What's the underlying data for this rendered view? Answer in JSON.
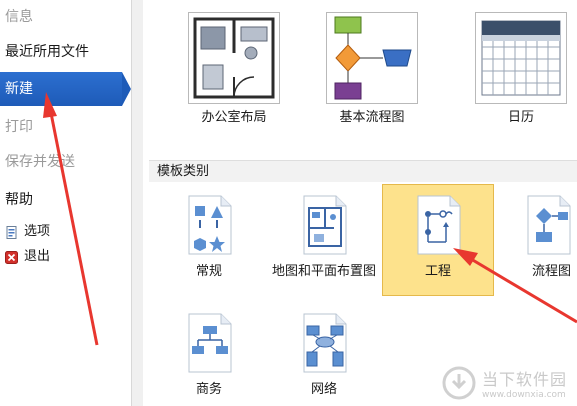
{
  "nav": {
    "info": "信息",
    "recent": "最近所用文件",
    "new": "新建",
    "print": "打印",
    "save_send": "保存并发送",
    "help": "帮助",
    "options": "选项",
    "exit": "退出"
  },
  "top_templates": [
    {
      "label": "办公室布局"
    },
    {
      "label": "基本流程图"
    },
    {
      "label": "日历"
    }
  ],
  "section": {
    "title": "模板类别"
  },
  "categories": [
    {
      "label": "常规"
    },
    {
      "label": "地图和平面布置图"
    },
    {
      "label": "工程"
    },
    {
      "label": "流程图"
    },
    {
      "label": "商务"
    },
    {
      "label": "网络"
    }
  ],
  "watermark": {
    "name": "当下软件园",
    "url": "www.downxia.com"
  },
  "colors": {
    "nav_selected": "#1e5bb8",
    "category_selected": "#fde28c",
    "annotation": "#e8372f"
  }
}
